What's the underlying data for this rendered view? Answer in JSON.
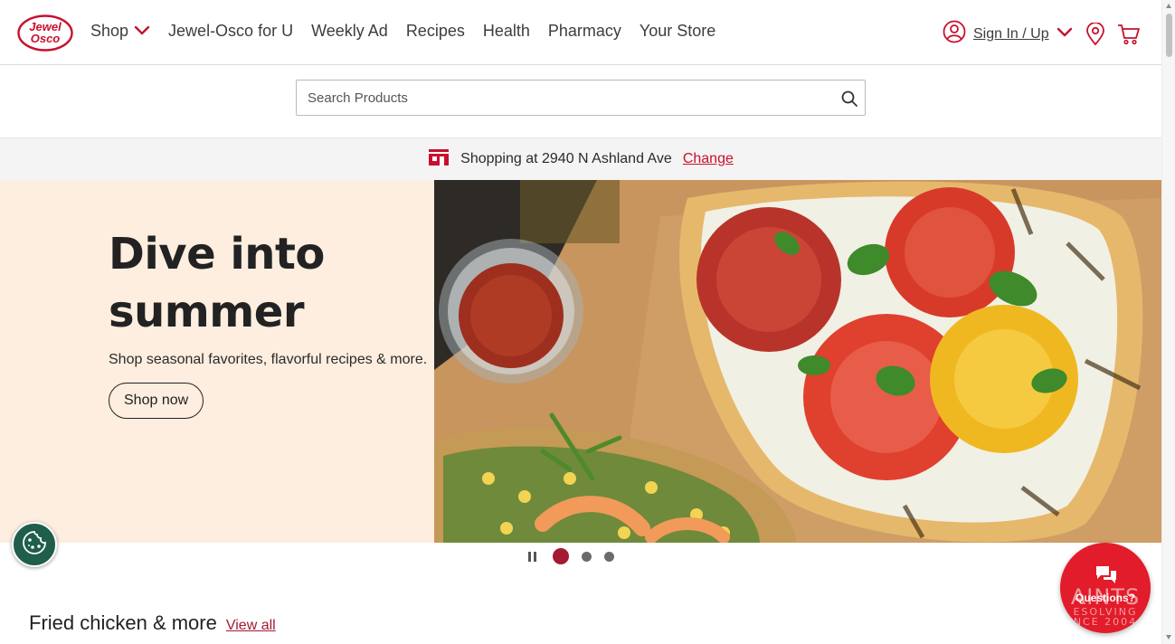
{
  "brand": {
    "logo_line1": "Jewel",
    "logo_line2": "Osco",
    "accent_color": "#c8102e",
    "dark_red": "#a31a32",
    "hero_bg": "#fdeedf"
  },
  "nav": {
    "items": [
      {
        "label": "Shop",
        "icon": "chevron-down-icon"
      },
      {
        "label": "Jewel-Osco for U"
      },
      {
        "label": "Weekly Ad"
      },
      {
        "label": "Recipes"
      },
      {
        "label": "Health"
      },
      {
        "label": "Pharmacy"
      },
      {
        "label": "Your Store"
      }
    ]
  },
  "account": {
    "signin_label": "Sign In / Up",
    "icons": [
      "user-circle-icon",
      "chevron-down-icon",
      "location-pin-icon",
      "cart-icon"
    ]
  },
  "search": {
    "placeholder": "Search Products",
    "value": "",
    "icon": "search-icon"
  },
  "store_bar": {
    "prefix": "Shopping at 2940 N Ashland Ave",
    "change_label": "Change",
    "icon": "store-icon"
  },
  "hero": {
    "title_line1": "Dive into",
    "title_line2": "summer",
    "subtitle": "Shop seasonal favorites, flavorful recipes & more.",
    "cta_label": "Shop now",
    "image": "grilled-flatbread-tomato-photo"
  },
  "carousel": {
    "slide_count": 3,
    "active_slide": 1,
    "pause_icon": "pause-icon"
  },
  "section": {
    "title": "Fried chicken & more",
    "view_all_label": "View all"
  },
  "cookie_button": {
    "icon": "cookie-icon",
    "color": "#1f5e4b"
  },
  "chat": {
    "label": "Questions?",
    "icon": "chat-bubbles-icon",
    "watermark_line1": "AINTS",
    "watermark_line2": "ESOLVING",
    "watermark_line3": "NCE 2004",
    "color": "#e21c2a"
  }
}
